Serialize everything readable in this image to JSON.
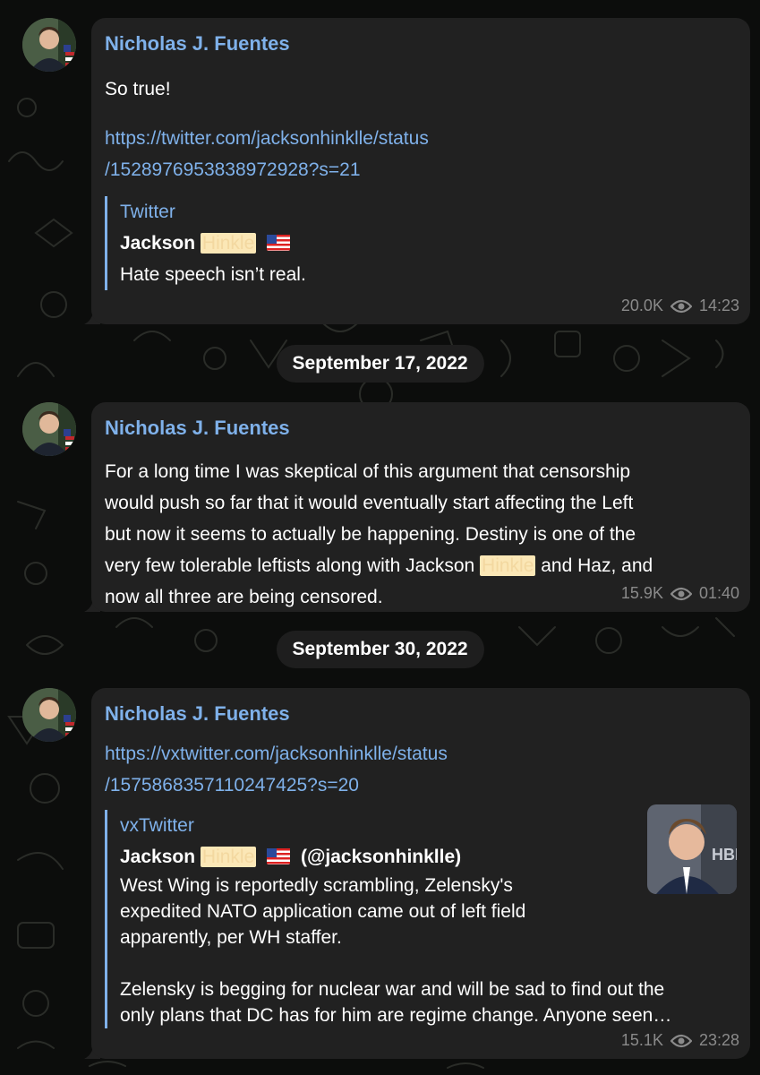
{
  "colors": {
    "background": "#0c0d0c",
    "bubble": "#212121",
    "link": "#7fb1ea",
    "highlight": "#fbe7b6",
    "meta": "#8a8a8a"
  },
  "messages": [
    {
      "sender": "Nicholas J. Fuentes",
      "text": "So true!",
      "link_line1": "https://twitter.com/jacksonhinklle/status",
      "link_line2": "/1528976953838972928?s=21",
      "preview": {
        "site": "Twitter",
        "author_first": "Jackson",
        "author_highlight": "Hinkle",
        "flag": "us-flag-emoji",
        "body": "Hate speech isn’t real."
      },
      "views": "20.0K",
      "time": "14:23"
    },
    {
      "date": "September 17, 2022",
      "sender": "Nicholas J. Fuentes",
      "lines": [
        "For a long time I was skeptical of this argument that censorship",
        "would push so far that it would eventually start affecting the Left",
        "but now it seems to actually be happening. Destiny is one of the",
        "very few tolerable leftists along with Jackson",
        "Hinkle",
        "and Haz, and",
        "now all three are being censored."
      ],
      "views": "15.9K",
      "time": "01:40"
    },
    {
      "date": "September 30, 2022",
      "sender": "Nicholas J. Fuentes",
      "link_line1": "https://vxtwitter.com/jacksonhinklle/status",
      "link_line2": "/1575868357110247425?s=20",
      "preview": {
        "site": "vxTwitter",
        "author_first": "Jackson",
        "author_highlight": "Hinkle",
        "flag": "us-flag-emoji",
        "handle": "(@jacksonhinklle)",
        "body_lines": [
          "West Wing is reportedly scrambling, Zelensky's",
          "expedited NATO application came out of left field",
          "apparently, per WH staffer.",
          "Zelensky is begging for nuclear war and will be sad to find out the",
          "only plans that DC has for him are regime change. Anyone seen…"
        ],
        "thumbnail_text": "HBI"
      },
      "views": "15.1K",
      "time": "23:28"
    }
  ],
  "icons": {
    "views": "eye-icon",
    "avatar": "profile-avatar"
  }
}
